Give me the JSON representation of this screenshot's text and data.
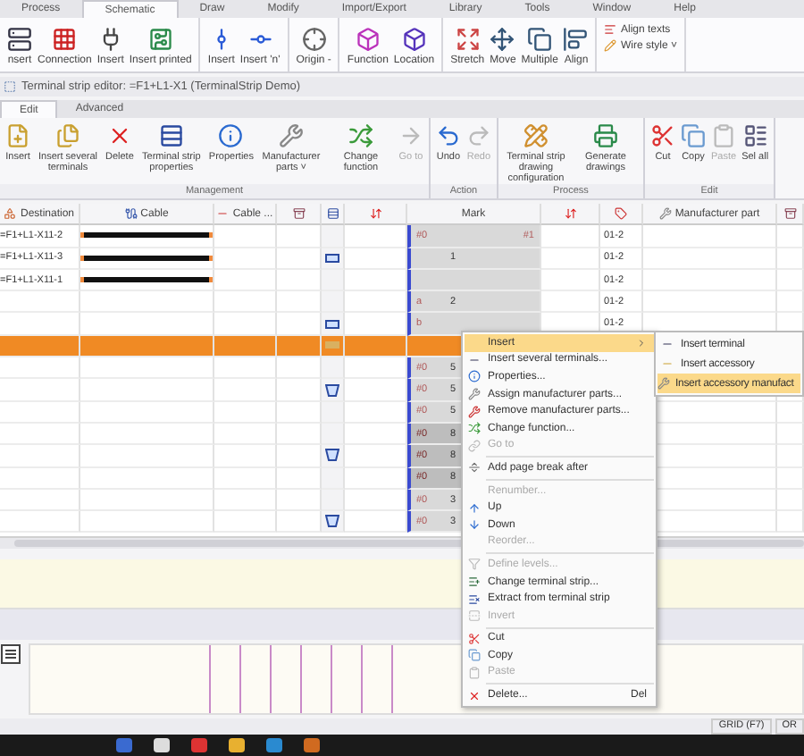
{
  "menu_tabs": [
    {
      "label": "Process",
      "selected": false
    },
    {
      "label": "Schematic",
      "selected": true
    },
    {
      "label": "Draw",
      "selected": false
    },
    {
      "label": "Modify",
      "selected": false
    },
    {
      "label": "Import/Export",
      "selected": false
    },
    {
      "label": "Library",
      "selected": false
    },
    {
      "label": "Tools",
      "selected": false
    },
    {
      "label": "Window",
      "selected": false
    },
    {
      "label": "Help",
      "selected": false
    }
  ],
  "ribbon_groups": [
    {
      "buttons": [
        {
          "label": "nsert"
        },
        {
          "label": "Connection"
        },
        {
          "label": "Insert"
        },
        {
          "label": "Insert printed"
        }
      ]
    },
    {
      "buttons": [
        {
          "label": "Insert"
        },
        {
          "label": "Insert 'n'"
        }
      ]
    },
    {
      "buttons": [
        {
          "label": "Origin -"
        }
      ]
    },
    {
      "buttons": [
        {
          "label": "Function"
        },
        {
          "label": "Location"
        }
      ]
    },
    {
      "buttons": [
        {
          "label": "Stretch"
        },
        {
          "label": "Move"
        },
        {
          "label": "Multiple"
        },
        {
          "label": "Align"
        }
      ]
    }
  ],
  "ribbon_small": [
    "Align texts",
    "Wire style ˅"
  ],
  "editor_title": "Terminal strip editor: =F1+L1-X1 (TerminalStrip Demo)",
  "editor_tabs": [
    {
      "label": "Edit",
      "selected": true
    },
    {
      "label": "Advanced",
      "selected": false
    }
  ],
  "editor_groups": [
    {
      "label": "Management",
      "buttons": [
        {
          "label": "Insert",
          "disabled": false
        },
        {
          "label": "Insert several terminals",
          "disabled": false
        },
        {
          "label": "Delete",
          "disabled": false
        },
        {
          "label": "Terminal strip properties",
          "disabled": false
        },
        {
          "label": "Properties",
          "disabled": false
        },
        {
          "label": "Manufacturer parts ˅",
          "disabled": false
        },
        {
          "label": "Change function",
          "disabled": false
        },
        {
          "label": "Go to",
          "disabled": true
        }
      ]
    },
    {
      "label": "Action",
      "buttons": [
        {
          "label": "Undo",
          "disabled": false
        },
        {
          "label": "Redo",
          "disabled": true
        }
      ]
    },
    {
      "label": "Process",
      "buttons": [
        {
          "label": "Terminal strip drawing configuration",
          "disabled": false
        },
        {
          "label": "Generate drawings",
          "disabled": false
        }
      ]
    },
    {
      "label": "Edit",
      "buttons": [
        {
          "label": "Cut",
          "disabled": false
        },
        {
          "label": "Copy",
          "disabled": false
        },
        {
          "label": "Paste",
          "disabled": true
        },
        {
          "label": "Sel all",
          "disabled": false
        }
      ]
    }
  ],
  "columns": [
    {
      "kind": "text",
      "label": "Destination"
    },
    {
      "kind": "text",
      "label": "Cable"
    },
    {
      "kind": "text",
      "label": "Cable ..."
    },
    {
      "kind": "icon"
    },
    {
      "kind": "icon"
    },
    {
      "kind": "sort"
    },
    {
      "kind": "text",
      "label": "Mark"
    },
    {
      "kind": "sort"
    },
    {
      "kind": "icon"
    },
    {
      "kind": "text",
      "label": "Manufacturer part"
    },
    {
      "kind": "icon"
    }
  ],
  "rows": [
    {
      "kind": "plain",
      "destination": "=F1+L1-X11-2",
      "cable": true,
      "mark_left": "#0",
      "mark_right": "#1",
      "shaded": true,
      "dark": false,
      "part": "01-2",
      "selected": false
    },
    {
      "kind": "terminal",
      "destination": "=F1+L1-X11-3",
      "cable": true,
      "mark": "1",
      "shaded": true,
      "dark": false,
      "part": "01-2",
      "selected": false
    },
    {
      "kind": "plain",
      "destination": "=F1+L1-X11-1",
      "cable": true,
      "shaded": true,
      "dark": false,
      "part": "01-2",
      "selected": false
    },
    {
      "kind": "plain",
      "cable": false,
      "mark_left": "a",
      "mark": "2",
      "shaded": true,
      "dark": false,
      "part": "01-2",
      "selected": false
    },
    {
      "kind": "terminal",
      "cable": false,
      "mark_left": "b",
      "shaded": true,
      "dark": false,
      "part": "01-2",
      "selected": false
    },
    {
      "kind": "accessory",
      "cable": false,
      "shaded": false,
      "dark": false,
      "selected": true
    },
    {
      "kind": "plain",
      "cable": false,
      "mark_left": "#0",
      "mark": "5",
      "shaded": true,
      "dark": false,
      "selected": false
    },
    {
      "kind": "level",
      "cable": false,
      "mark_left": "#0",
      "mark": "5",
      "shaded": true,
      "dark": false,
      "selected": false
    },
    {
      "kind": "plain",
      "cable": false,
      "mark_left": "#0",
      "mark": "5",
      "shaded": true,
      "dark": false,
      "selected": false
    },
    {
      "kind": "plain",
      "cable": false,
      "mark_left": "#0",
      "mark": "8",
      "shaded": true,
      "dark": true,
      "selected": false
    },
    {
      "kind": "level",
      "cable": false,
      "mark_left": "#0",
      "mark": "8",
      "shaded": true,
      "dark": true,
      "selected": false
    },
    {
      "kind": "plain",
      "cable": false,
      "mark_left": "#0",
      "mark": "8",
      "shaded": true,
      "dark": true,
      "selected": false
    },
    {
      "kind": "plain",
      "cable": false,
      "mark_left": "#0",
      "mark": "3",
      "shaded": true,
      "dark": false,
      "selected": false
    },
    {
      "kind": "level",
      "cable": false,
      "mark_left": "#0",
      "mark": "3",
      "shaded": true,
      "dark": false,
      "selected": false
    }
  ],
  "context_menu": [
    {
      "kind": "item",
      "label": "Insert",
      "submenu": true,
      "highlighted": true,
      "disabled": false
    },
    {
      "kind": "item",
      "label": "Insert several terminals...",
      "submenu": false,
      "highlighted": false,
      "disabled": false
    },
    {
      "kind": "item",
      "label": "Properties...",
      "submenu": false,
      "highlighted": false,
      "disabled": false
    },
    {
      "kind": "item",
      "label": "Assign manufacturer parts...",
      "submenu": false,
      "highlighted": false,
      "disabled": false
    },
    {
      "kind": "item",
      "label": "Remove manufacturer parts...",
      "submenu": false,
      "highlighted": false,
      "disabled": false
    },
    {
      "kind": "item",
      "label": "Change function...",
      "submenu": false,
      "highlighted": false,
      "disabled": false
    },
    {
      "kind": "item",
      "label": "Go to",
      "submenu": false,
      "highlighted": false,
      "disabled": true
    },
    {
      "kind": "separator"
    },
    {
      "kind": "item",
      "label": "Add page break after",
      "submenu": false,
      "highlighted": false,
      "disabled": false
    },
    {
      "kind": "separator"
    },
    {
      "kind": "item",
      "label": "Renumber...",
      "submenu": false,
      "highlighted": false,
      "disabled": true
    },
    {
      "kind": "item",
      "label": "Up",
      "submenu": false,
      "highlighted": false,
      "disabled": false
    },
    {
      "kind": "item",
      "label": "Down",
      "submenu": false,
      "highlighted": false,
      "disabled": false
    },
    {
      "kind": "item",
      "label": "Reorder...",
      "submenu": false,
      "highlighted": false,
      "disabled": true
    },
    {
      "kind": "separator"
    },
    {
      "kind": "item",
      "label": "Define levels...",
      "submenu": false,
      "highlighted": false,
      "disabled": true
    },
    {
      "kind": "item",
      "label": "Change terminal strip...",
      "submenu": false,
      "highlighted": false,
      "disabled": false
    },
    {
      "kind": "item",
      "label": "Extract from terminal strip",
      "submenu": false,
      "highlighted": false,
      "disabled": false
    },
    {
      "kind": "item",
      "label": "Invert",
      "submenu": false,
      "highlighted": false,
      "disabled": true
    },
    {
      "kind": "separator"
    },
    {
      "kind": "item",
      "label": "Cut",
      "submenu": false,
      "highlighted": false,
      "disabled": false
    },
    {
      "kind": "item",
      "label": "Copy",
      "submenu": false,
      "highlighted": false,
      "disabled": false
    },
    {
      "kind": "item",
      "label": "Paste",
      "submenu": false,
      "highlighted": false,
      "disabled": true
    },
    {
      "kind": "separator"
    },
    {
      "kind": "item",
      "label": "Delete...",
      "shortcut": "Del",
      "submenu": false,
      "highlighted": false,
      "disabled": false
    }
  ],
  "submenu": [
    {
      "label": "Insert terminal",
      "highlighted": false
    },
    {
      "label": "Insert accessory",
      "highlighted": false
    },
    {
      "label": "Insert accessory manufact",
      "highlighted": true
    }
  ],
  "status_bar": [
    "GRID (F7)",
    "OR"
  ]
}
